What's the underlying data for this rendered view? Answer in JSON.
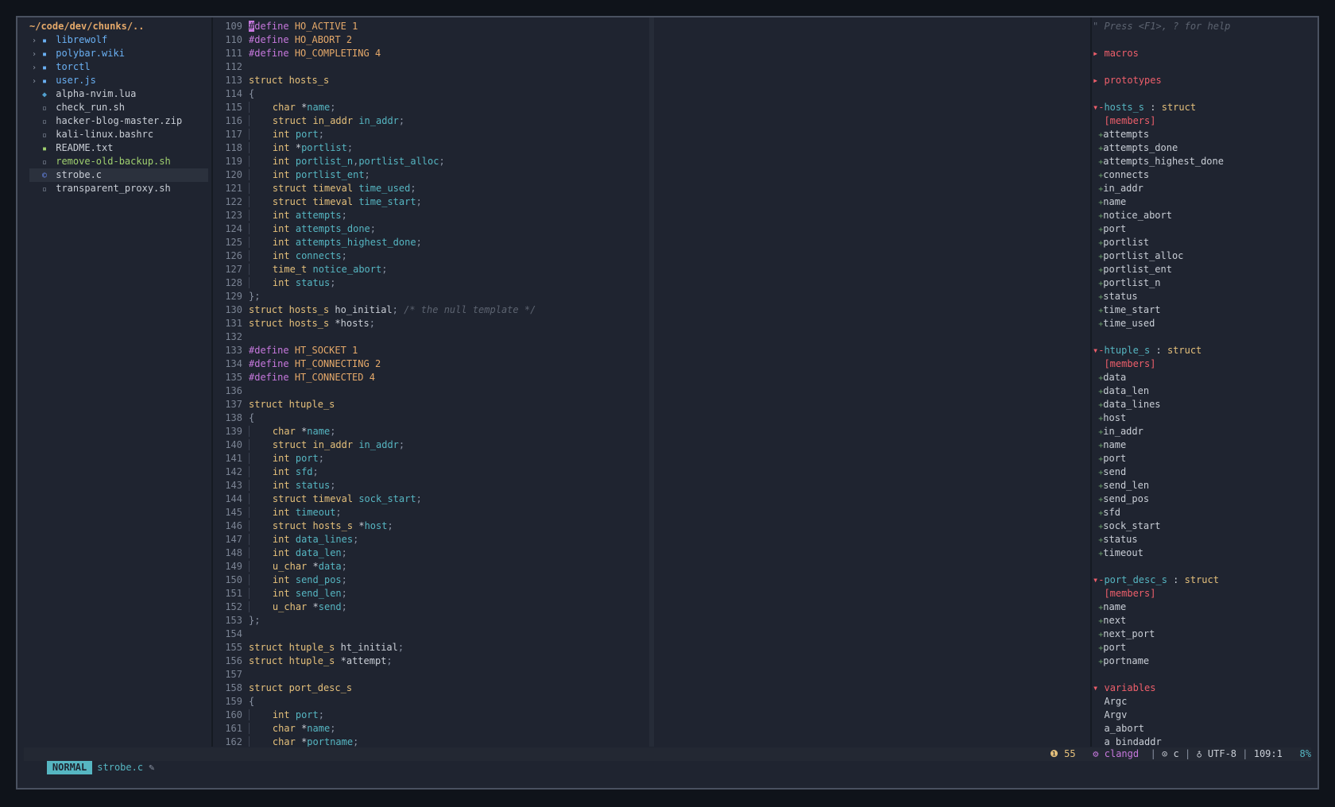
{
  "tree": {
    "root": "~/code/dev/chunks/..",
    "items": [
      {
        "twist": "›",
        "icon": "▪",
        "label": "librewolf",
        "type": "dir"
      },
      {
        "twist": "›",
        "icon": "▪",
        "label": "polybar.wiki",
        "type": "dir"
      },
      {
        "twist": "›",
        "icon": "▪",
        "label": "torctl",
        "type": "dir"
      },
      {
        "twist": "›",
        "icon": "▪",
        "label": "user.js",
        "type": "dir"
      },
      {
        "twist": "",
        "icon": "◆",
        "label": "alpha-nvim.lua",
        "type": "file"
      },
      {
        "twist": "",
        "icon": "▫",
        "label": "check_run.sh",
        "type": "file"
      },
      {
        "twist": "",
        "icon": "▫",
        "label": "hacker-blog-master.zip",
        "type": "file"
      },
      {
        "twist": "",
        "icon": "▫",
        "label": "kali-linux.bashrc",
        "type": "file"
      },
      {
        "twist": "",
        "icon": "▪",
        "label": "README.txt",
        "type": "file"
      },
      {
        "twist": "",
        "icon": "▫",
        "label": "remove-old-backup.sh",
        "type": "exec"
      },
      {
        "twist": "",
        "icon": "©",
        "label": "strobe.c",
        "type": "file",
        "selected": true
      },
      {
        "twist": "",
        "icon": "▫",
        "label": "transparent_proxy.sh",
        "type": "file"
      }
    ]
  },
  "editor": {
    "lines": [
      {
        "n": "109",
        "h": "<span class='cursor'>#</span><span class='kw-p'>define</span> <span class='mac'>HO_ACTIVE</span> <span class='num'>1</span>"
      },
      {
        "n": "110",
        "h": "<span class='kw-p'>#define</span> <span class='mac'>HO_ABORT</span> <span class='num'>2</span>"
      },
      {
        "n": "111",
        "h": "<span class='kw-p'>#define</span> <span class='mac'>HO_COMPLETING</span> <span class='num'>4</span>"
      },
      {
        "n": "112",
        "h": ""
      },
      {
        "n": "113",
        "h": "<span class='kw'>struct</span> <span class='ty'>hosts_s</span>"
      },
      {
        "n": "114",
        "h": "<span class='punc'>{</span>"
      },
      {
        "n": "115",
        "h": "<span class='guide'>   </span> <span class='kw'>char</span> <span class='txt'>*</span><span class='id'>name</span><span class='punc'>;</span>"
      },
      {
        "n": "116",
        "h": "<span class='guide'>   </span> <span class='kw'>struct</span> <span class='ty'>in_addr</span> <span class='id'>in_addr</span><span class='punc'>;</span>"
      },
      {
        "n": "117",
        "h": "<span class='guide'>   </span> <span class='kw'>int</span> <span class='id'>port</span><span class='punc'>;</span>"
      },
      {
        "n": "118",
        "h": "<span class='guide'>   </span> <span class='kw'>int</span> <span class='txt'>*</span><span class='id'>portlist</span><span class='punc'>;</span>"
      },
      {
        "n": "119",
        "h": "<span class='guide'>   </span> <span class='kw'>int</span> <span class='id'>portlist_n</span><span class='punc'>,</span><span class='id'>portlist_alloc</span><span class='punc'>;</span>"
      },
      {
        "n": "120",
        "h": "<span class='guide'>   </span> <span class='kw'>int</span> <span class='id'>portlist_ent</span><span class='punc'>;</span>"
      },
      {
        "n": "121",
        "h": "<span class='guide'>   </span> <span class='kw'>struct</span> <span class='ty'>timeval</span> <span class='id'>time_used</span><span class='punc'>;</span>"
      },
      {
        "n": "122",
        "h": "<span class='guide'>   </span> <span class='kw'>struct</span> <span class='ty'>timeval</span> <span class='id'>time_start</span><span class='punc'>;</span>"
      },
      {
        "n": "123",
        "h": "<span class='guide'>   </span> <span class='kw'>int</span> <span class='id'>attempts</span><span class='punc'>;</span>"
      },
      {
        "n": "124",
        "h": "<span class='guide'>   </span> <span class='kw'>int</span> <span class='id'>attempts_done</span><span class='punc'>;</span>"
      },
      {
        "n": "125",
        "h": "<span class='guide'>   </span> <span class='kw'>int</span> <span class='id'>attempts_highest_done</span><span class='punc'>;</span>"
      },
      {
        "n": "126",
        "h": "<span class='guide'>   </span> <span class='kw'>int</span> <span class='id'>connects</span><span class='punc'>;</span>"
      },
      {
        "n": "127",
        "h": "<span class='guide'>   </span> <span class='ty'>time_t</span> <span class='id'>notice_abort</span><span class='punc'>;</span>"
      },
      {
        "n": "128",
        "h": "<span class='guide'>   </span> <span class='kw'>int</span> <span class='id'>status</span><span class='punc'>;</span>"
      },
      {
        "n": "129",
        "h": "<span class='punc'>};</span>"
      },
      {
        "n": "130",
        "h": "<span class='kw'>struct</span> <span class='ty'>hosts_s</span> <span class='txt'>ho_initial</span><span class='punc'>;</span> <span class='cm'>/* the null template */</span>"
      },
      {
        "n": "131",
        "h": "<span class='kw'>struct</span> <span class='ty'>hosts_s</span> <span class='txt'>*hosts</span><span class='punc'>;</span>"
      },
      {
        "n": "132",
        "h": ""
      },
      {
        "n": "133",
        "h": "<span class='kw-p'>#define</span> <span class='mac'>HT_SOCKET</span> <span class='num'>1</span>"
      },
      {
        "n": "134",
        "h": "<span class='kw-p'>#define</span> <span class='mac'>HT_CONNECTING</span> <span class='num'>2</span>"
      },
      {
        "n": "135",
        "h": "<span class='kw-p'>#define</span> <span class='mac'>HT_CONNECTED</span> <span class='num'>4</span>"
      },
      {
        "n": "136",
        "h": ""
      },
      {
        "n": "137",
        "h": "<span class='kw'>struct</span> <span class='ty'>htuple_s</span>"
      },
      {
        "n": "138",
        "h": "<span class='punc'>{</span>"
      },
      {
        "n": "139",
        "h": "<span class='guide'>   </span> <span class='kw'>char</span> <span class='txt'>*</span><span class='id'>name</span><span class='punc'>;</span>"
      },
      {
        "n": "140",
        "h": "<span class='guide'>   </span> <span class='kw'>struct</span> <span class='ty'>in_addr</span> <span class='id'>in_addr</span><span class='punc'>;</span>"
      },
      {
        "n": "141",
        "h": "<span class='guide'>   </span> <span class='kw'>int</span> <span class='id'>port</span><span class='punc'>;</span>"
      },
      {
        "n": "142",
        "h": "<span class='guide'>   </span> <span class='kw'>int</span> <span class='id'>sfd</span><span class='punc'>;</span>"
      },
      {
        "n": "143",
        "h": "<span class='guide'>   </span> <span class='kw'>int</span> <span class='id'>status</span><span class='punc'>;</span>"
      },
      {
        "n": "144",
        "h": "<span class='guide'>   </span> <span class='kw'>struct</span> <span class='ty'>timeval</span> <span class='id'>sock_start</span><span class='punc'>;</span>"
      },
      {
        "n": "145",
        "h": "<span class='guide'>   </span> <span class='kw'>int</span> <span class='id'>timeout</span><span class='punc'>;</span>"
      },
      {
        "n": "146",
        "h": "<span class='guide'>   </span> <span class='kw'>struct</span> <span class='ty'>hosts_s</span> <span class='txt'>*</span><span class='id'>host</span><span class='punc'>;</span>"
      },
      {
        "n": "147",
        "h": "<span class='guide'>   </span> <span class='kw'>int</span> <span class='id'>data_lines</span><span class='punc'>;</span>"
      },
      {
        "n": "148",
        "h": "<span class='guide'>   </span> <span class='kw'>int</span> <span class='id'>data_len</span><span class='punc'>;</span>"
      },
      {
        "n": "149",
        "h": "<span class='guide'>   </span> <span class='ty'>u_char</span> <span class='txt'>*</span><span class='id'>data</span><span class='punc'>;</span>"
      },
      {
        "n": "150",
        "h": "<span class='guide'>   </span> <span class='kw'>int</span> <span class='id'>send_pos</span><span class='punc'>;</span>"
      },
      {
        "n": "151",
        "h": "<span class='guide'>   </span> <span class='kw'>int</span> <span class='id'>send_len</span><span class='punc'>;</span>"
      },
      {
        "n": "152",
        "h": "<span class='guide'>   </span> <span class='ty'>u_char</span> <span class='txt'>*</span><span class='id'>send</span><span class='punc'>;</span>"
      },
      {
        "n": "153",
        "h": "<span class='punc'>};</span>"
      },
      {
        "n": "154",
        "h": ""
      },
      {
        "n": "155",
        "h": "<span class='kw'>struct</span> <span class='ty'>htuple_s</span> <span class='txt'>ht_initial</span><span class='punc'>;</span>"
      },
      {
        "n": "156",
        "h": "<span class='kw'>struct</span> <span class='ty'>htuple_s</span> <span class='txt'>*attempt</span><span class='punc'>;</span>"
      },
      {
        "n": "157",
        "h": ""
      },
      {
        "n": "158",
        "h": "<span class='kw'>struct</span> <span class='ty'>port_desc_s</span>"
      },
      {
        "n": "159",
        "h": "<span class='punc'>{</span>"
      },
      {
        "n": "160",
        "h": "<span class='guide'>   </span> <span class='kw'>int</span> <span class='id'>port</span><span class='punc'>;</span>"
      },
      {
        "n": "161",
        "h": "<span class='guide'>   </span> <span class='kw'>char</span> <span class='txt'>*</span><span class='id'>name</span><span class='punc'>;</span>"
      },
      {
        "n": "162",
        "h": "<span class='guide'>   </span> <span class='kw'>char</span> <span class='txt'>*</span><span class='id'>portname</span><span class='punc'>;</span>"
      }
    ]
  },
  "tagbar": {
    "hint": "\" Press <F1>, ? for help",
    "rows": [
      {
        "t": "hint"
      },
      {
        "t": "blank"
      },
      {
        "t": "kind",
        "fold": "▸",
        "label": "macros"
      },
      {
        "t": "blank"
      },
      {
        "t": "kind",
        "fold": "▸",
        "label": "prototypes"
      },
      {
        "t": "blank"
      },
      {
        "t": "struct",
        "fold": "▾-",
        "name": "hosts_s",
        "sep": " : ",
        "stype": "struct"
      },
      {
        "t": "mem",
        "label": "[members]"
      },
      {
        "t": "item",
        "label": "attempts"
      },
      {
        "t": "item",
        "label": "attempts_done"
      },
      {
        "t": "item",
        "label": "attempts_highest_done"
      },
      {
        "t": "item",
        "label": "connects"
      },
      {
        "t": "item",
        "label": "in_addr"
      },
      {
        "t": "item",
        "label": "name"
      },
      {
        "t": "item",
        "label": "notice_abort"
      },
      {
        "t": "item",
        "label": "port"
      },
      {
        "t": "item",
        "label": "portlist"
      },
      {
        "t": "item",
        "label": "portlist_alloc"
      },
      {
        "t": "item",
        "label": "portlist_ent"
      },
      {
        "t": "item",
        "label": "portlist_n"
      },
      {
        "t": "item",
        "label": "status"
      },
      {
        "t": "item",
        "label": "time_start"
      },
      {
        "t": "item",
        "label": "time_used"
      },
      {
        "t": "blank"
      },
      {
        "t": "struct",
        "fold": "▾-",
        "name": "htuple_s",
        "sep": " : ",
        "stype": "struct"
      },
      {
        "t": "mem",
        "label": "[members]"
      },
      {
        "t": "item",
        "label": "data"
      },
      {
        "t": "item",
        "label": "data_len"
      },
      {
        "t": "item",
        "label": "data_lines"
      },
      {
        "t": "item",
        "label": "host"
      },
      {
        "t": "item",
        "label": "in_addr"
      },
      {
        "t": "item",
        "label": "name"
      },
      {
        "t": "item",
        "label": "port"
      },
      {
        "t": "item",
        "label": "send"
      },
      {
        "t": "item",
        "label": "send_len"
      },
      {
        "t": "item",
        "label": "send_pos"
      },
      {
        "t": "item",
        "label": "sfd"
      },
      {
        "t": "item",
        "label": "sock_start"
      },
      {
        "t": "item",
        "label": "status"
      },
      {
        "t": "item",
        "label": "timeout"
      },
      {
        "t": "blank"
      },
      {
        "t": "struct",
        "fold": "▾-",
        "name": "port_desc_s",
        "sep": " : ",
        "stype": "struct"
      },
      {
        "t": "mem",
        "label": "[members]"
      },
      {
        "t": "item",
        "label": "name"
      },
      {
        "t": "item",
        "label": "next"
      },
      {
        "t": "item",
        "label": "next_port"
      },
      {
        "t": "item",
        "label": "port"
      },
      {
        "t": "item",
        "label": "portname"
      },
      {
        "t": "blank"
      },
      {
        "t": "kind",
        "fold": "▾",
        "label": "variables"
      },
      {
        "t": "var",
        "label": "Argc"
      },
      {
        "t": "var",
        "label": "Argv"
      },
      {
        "t": "var",
        "label": "a_abort"
      },
      {
        "t": "var",
        "label": "a_bindaddr"
      }
    ]
  },
  "status": {
    "mode": "NORMAL",
    "file": "strobe.c",
    "edit_icon": "✎",
    "warn_icon": "❶",
    "warn_count": "55",
    "lsp_icon": "⚙",
    "lsp": "clangd",
    "ft_icon": "⊙",
    "filetype": "c",
    "enc_icon": "♁",
    "encoding": "UTF-8",
    "position": "109:1",
    "percent": "8%"
  }
}
